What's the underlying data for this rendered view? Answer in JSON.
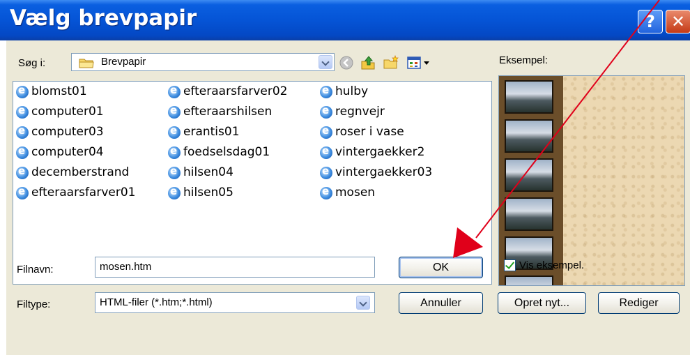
{
  "dialog": {
    "title": "Vælg brevpapir",
    "help_label": "?",
    "close_label": "✕"
  },
  "lookin": {
    "label": "Søg i:",
    "value": "Brevpapir"
  },
  "toolbar": {
    "icons": [
      "back-icon",
      "up-folder-icon",
      "new-folder-icon",
      "view-menu-icon"
    ]
  },
  "files": {
    "columns": [
      [
        "blomst01",
        "computer01",
        "computer03",
        "computer04",
        "decemberstrand",
        "efteraarsfarver01"
      ],
      [
        "efteraarsfarver02",
        "efteraarshilsen",
        "erantis01",
        "foedselsdag01",
        "hilsen04",
        "hilsen05"
      ],
      [
        "hulby",
        "regnvejr",
        "roser i vase",
        "vintergaekker2",
        "vintergaekker03",
        "mosen"
      ]
    ]
  },
  "preview": {
    "label": "Eksempel:",
    "show_label": "Vis eksempel.",
    "show_checked": true
  },
  "filename": {
    "label": "Filnavn:",
    "value": "mosen.htm"
  },
  "filetype": {
    "label": "Filtype:",
    "value": "HTML-filer (*.htm;*.html)"
  },
  "buttons": {
    "ok": "OK",
    "cancel": "Annuller",
    "create_new": "Opret nyt...",
    "edit": "Rediger"
  },
  "colors": {
    "titlebar": "#0554d6",
    "dialog_bg": "#ece9d8",
    "annotation_arrow": "#e0001a"
  }
}
